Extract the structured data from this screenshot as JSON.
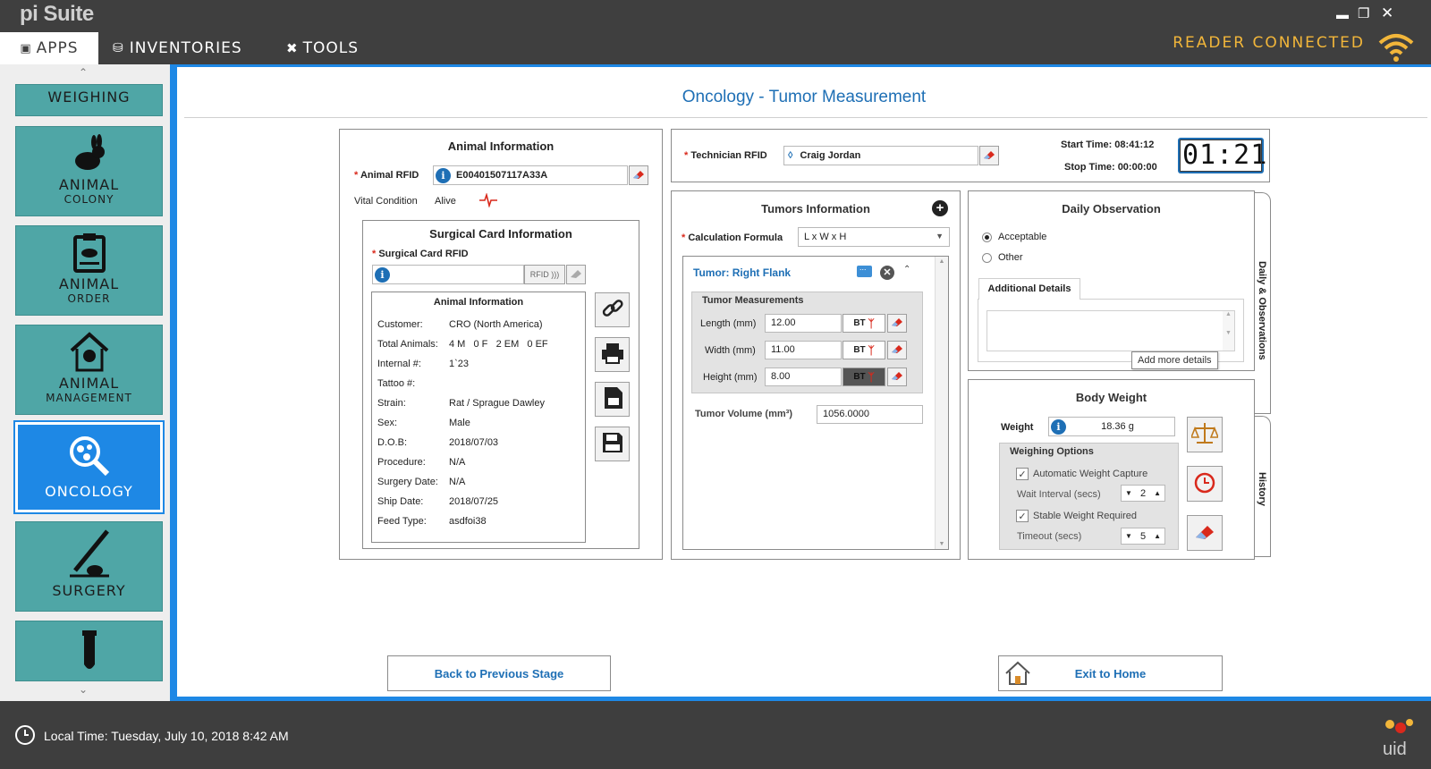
{
  "app": {
    "name": "pi Suite",
    "reader_status": "READER CONNECTED"
  },
  "menu": {
    "apps": "APPS",
    "inventories": "INVENTORIES",
    "tools": "TOOLS"
  },
  "sidebar": {
    "items": [
      {
        "line1": "WEIGHING",
        "line2": ""
      },
      {
        "line1": "ANIMAL",
        "line2": "COLONY"
      },
      {
        "line1": "ANIMAL",
        "line2": "ORDER"
      },
      {
        "line1": "ANIMAL",
        "line2": "MANAGEMENT"
      },
      {
        "line1": "ONCOLOGY",
        "line2": ""
      },
      {
        "line1": "SURGERY",
        "line2": ""
      }
    ]
  },
  "page": {
    "title": "Oncology - Tumor Measurement"
  },
  "animal_info": {
    "title": "Animal Information",
    "rfid_label": "Animal RFID",
    "rfid_value": "E00401507117A33A",
    "vital_label": "Vital Condition",
    "vital_value": "Alive",
    "surgical": {
      "title": "Surgical Card Information",
      "rfid_label": "Surgical Card RFID",
      "rfid_btn": "RFID",
      "inner_title": "Animal Information",
      "fields": [
        {
          "k": "Customer:",
          "v": "CRO (North America)"
        },
        {
          "k": "Total Animals:",
          "v": "4 M   0 F   2 EM   0 EF"
        },
        {
          "k": "Internal #:",
          "v": "1`23"
        },
        {
          "k": "Tattoo #:",
          "v": ""
        },
        {
          "k": "Strain:",
          "v": "Rat / Sprague Dawley"
        },
        {
          "k": "Sex:",
          "v": "Male"
        },
        {
          "k": "D.O.B:",
          "v": "2018/07/03"
        },
        {
          "k": "Procedure:",
          "v": "N/A"
        },
        {
          "k": "Surgery Date:",
          "v": "N/A"
        },
        {
          "k": "Ship Date:",
          "v": "2018/07/25"
        },
        {
          "k": "Feed Type:",
          "v": "asdfoi38"
        }
      ]
    }
  },
  "technician": {
    "label": "Technician RFID",
    "value": "Craig Jordan",
    "start_time": "Start Time: 08:41:12",
    "stop_time": "Stop Time: 00:00:00",
    "timer": "01:21"
  },
  "tumors": {
    "title": "Tumors Information",
    "formula_label": "Calculation Formula",
    "formula_value": "L x W x H",
    "tumor_name": "Tumor: Right Flank",
    "measurements_title": "Tumor Measurements",
    "length_label": "Length (mm)",
    "length_value": "12.00",
    "width_label": "Width (mm)",
    "width_value": "11.00",
    "height_label": "Height (mm)",
    "height_value": "8.00",
    "bt": "BT",
    "volume_label": "Tumor Volume (mm³)",
    "volume_value": "1056.0000"
  },
  "observation": {
    "title": "Daily Observation",
    "option_acceptable": "Acceptable",
    "option_other": "Other",
    "details_tab": "Additional Details",
    "tooltip": "Add more details",
    "side_tab": "Daily & Observations",
    "history_tab": "History"
  },
  "body_weight": {
    "title": "Body Weight",
    "weight_label": "Weight",
    "weight_value": "18.36 g",
    "options_title": "Weighing Options",
    "auto_capture": "Automatic Weight Capture",
    "wait_label": "Wait Interval (secs)",
    "wait_value": "2",
    "stable_required": "Stable Weight Required",
    "timeout_label": "Timeout (secs)",
    "timeout_value": "5"
  },
  "footer": {
    "back": "Back to Previous Stage",
    "exit": "Exit to Home"
  },
  "status": {
    "local_time": "Local Time: Tuesday, July 10, 2018  8:42 AM"
  },
  "colors": {
    "accent": "#1e88e5",
    "teal": "#4fa6a6",
    "reader": "#f2b63a",
    "title": "#1e6fb5"
  }
}
